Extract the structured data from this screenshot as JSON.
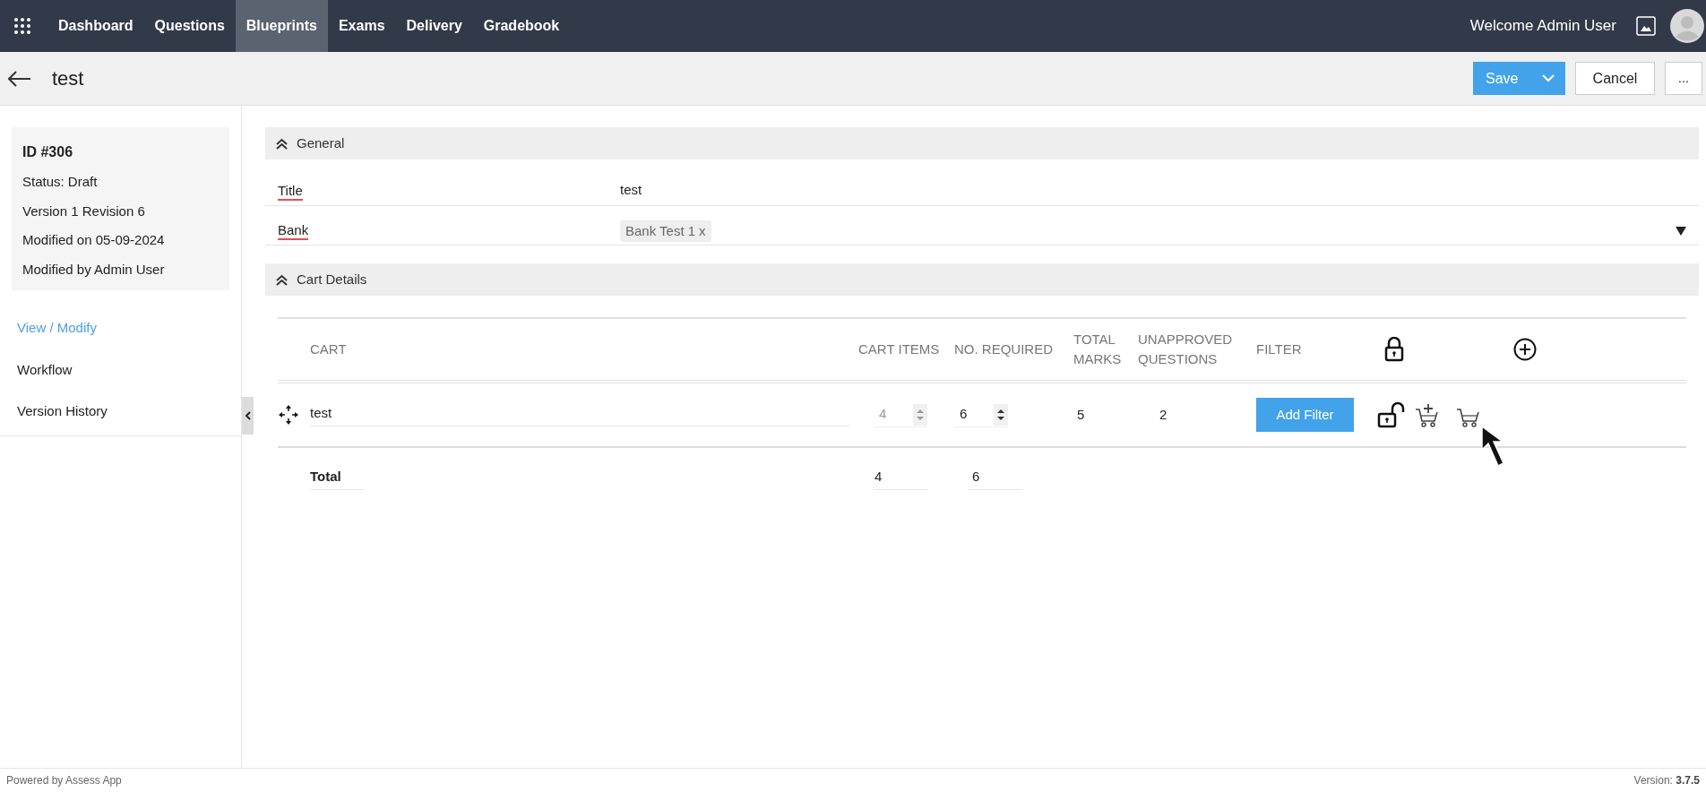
{
  "nav": {
    "items": [
      {
        "label": "Dashboard",
        "selected": false
      },
      {
        "label": "Questions",
        "selected": false
      },
      {
        "label": "Blueprints",
        "selected": true
      },
      {
        "label": "Exams",
        "selected": false
      },
      {
        "label": "Delivery",
        "selected": false
      },
      {
        "label": "Gradebook",
        "selected": false
      }
    ],
    "welcome": "Welcome Admin User"
  },
  "header": {
    "title": "test",
    "save": "Save",
    "cancel": "Cancel",
    "more": "..."
  },
  "sidebar": {
    "info": {
      "id": "ID #306",
      "lines": [
        "Status: Draft",
        "Version 1 Revision 6",
        "Modified on 05-09-2024",
        "Modified by Admin User"
      ]
    },
    "items": [
      {
        "label": "View / Modify",
        "selected": true
      },
      {
        "label": "Workflow",
        "selected": false
      },
      {
        "label": "Version History",
        "selected": false
      }
    ]
  },
  "general": {
    "heading": "General",
    "title_label": "Title",
    "title_value": "test",
    "bank_label": "Bank",
    "bank_chips": [
      {
        "label": "Bank Test 1",
        "remove": "x"
      }
    ]
  },
  "cart_details": {
    "heading": "Cart Details",
    "columns": [
      "CART",
      "CART ITEMS",
      "NO. REQUIRED",
      "TOTAL MARKS",
      "UNAPPROVED QUESTIONS",
      "FILTER"
    ],
    "rows": [
      {
        "name": "test",
        "cart_items": "4",
        "cart_items_disabled": true,
        "no_required": "6",
        "total_marks": "5",
        "unapproved": "2",
        "filter_button": "Add Filter",
        "locked": false
      }
    ],
    "total": {
      "label": "Total",
      "cart_items": "4",
      "no_required": "6"
    }
  },
  "footer": {
    "powered": "Powered by Assess App",
    "version_label": "Version: ",
    "version": "3.7.5"
  }
}
